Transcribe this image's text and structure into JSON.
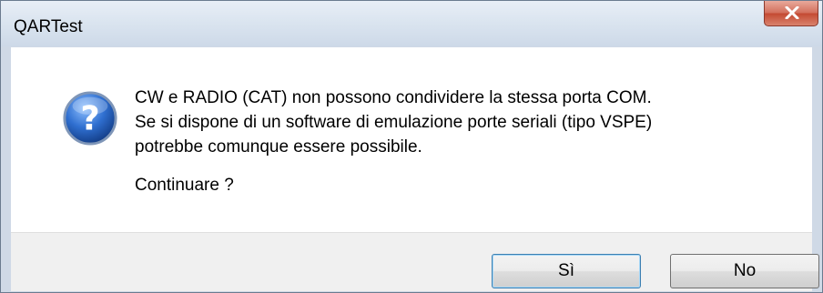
{
  "window": {
    "title": "QARTest"
  },
  "icons": {
    "close": "close-icon",
    "question": "question-icon"
  },
  "message": {
    "line1": "CW e RADIO (CAT) non possono condividere la stessa porta COM.",
    "line2": "Se si dispone di un software di emulazione porte seriali (tipo VSPE)",
    "line3": "potrebbe comunque essere possibile.",
    "prompt": "Continuare ?"
  },
  "buttons": {
    "yes_label": "Sì",
    "no_label": "No"
  },
  "colors": {
    "close_button": "#c44a32",
    "question_icon": "#2a5fb3",
    "default_button_border": "#3c7fb1"
  }
}
